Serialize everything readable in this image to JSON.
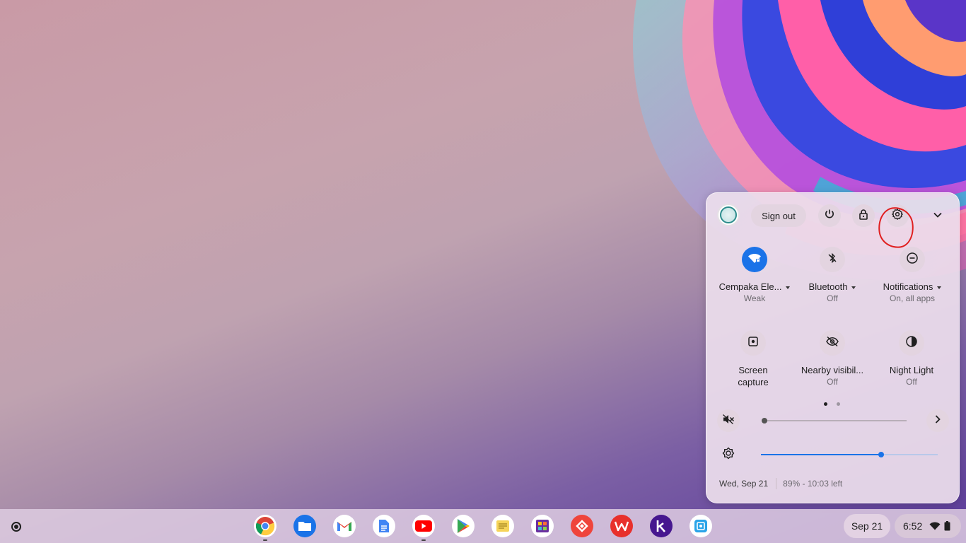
{
  "quick_settings": {
    "sign_out_label": "Sign out",
    "tiles": [
      {
        "label": "Cempaka Ele...",
        "sub": "Weak"
      },
      {
        "label": "Bluetooth",
        "sub": "Off"
      },
      {
        "label": "Notifications",
        "sub": "On, all apps"
      },
      {
        "label_line1": "Screen",
        "label_line2": "capture"
      },
      {
        "label": "Nearby visibil...",
        "sub": "Off"
      },
      {
        "label": "Night Light",
        "sub": "Off"
      }
    ],
    "volume_level": 0,
    "brightness_level": 0.68,
    "date": "Wed, Sep 21",
    "battery": "89% - 10:03 left",
    "page": 1,
    "page_count": 2
  },
  "shelf": {
    "apps": [
      "chrome-icon",
      "files-icon",
      "gmail-icon",
      "docs-icon",
      "youtube-icon",
      "play-store-icon",
      "notes-icon",
      "photo-app-icon",
      "anydesk-icon",
      "wps-office-icon",
      "kahoot-icon",
      "screenshot-app-icon"
    ],
    "date": "Sep 21",
    "time": "6:52"
  },
  "colors": {
    "accent": "#1a73e8",
    "annotation": "#e02020"
  }
}
